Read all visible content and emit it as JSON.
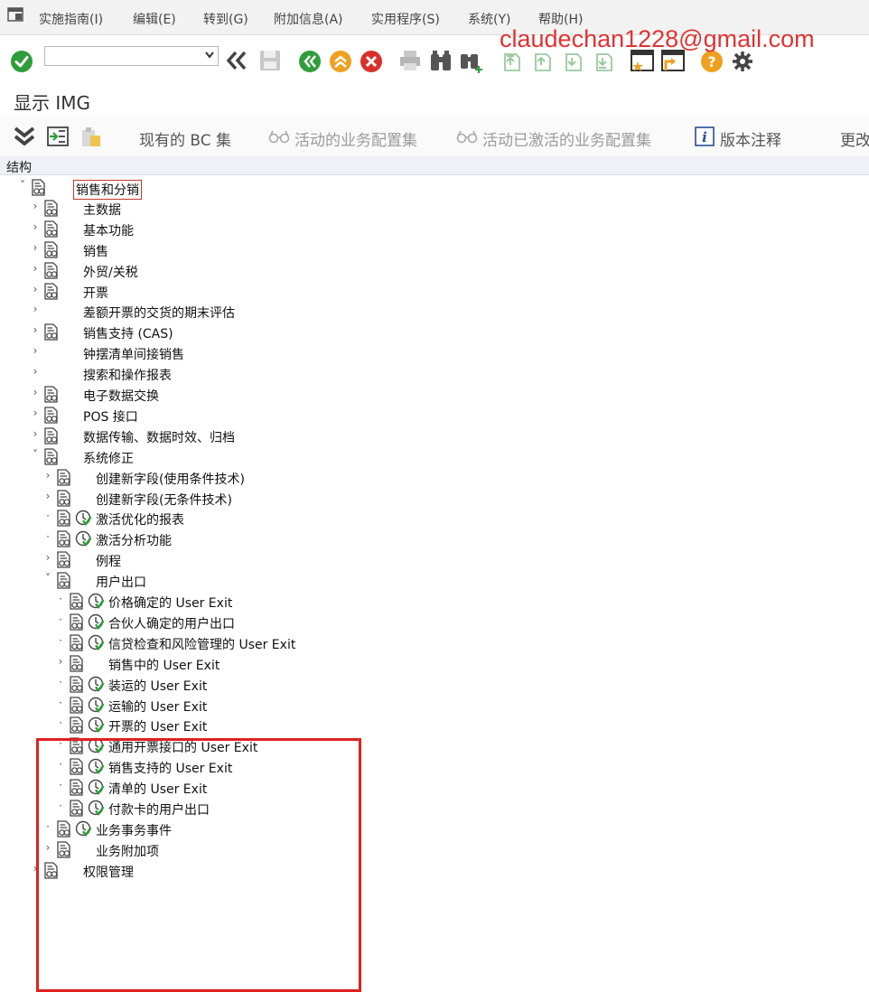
{
  "menu": [
    "实施指南(I)",
    "编辑(E)",
    "转到(G)",
    "附加信息(A)",
    "实用程序(S)",
    "系统(Y)",
    "帮助(H)"
  ],
  "watermark": "claudechan1228@gmail.com",
  "command_field": {
    "value": "",
    "placeholder": ""
  },
  "title": "显示 IMG",
  "app_toolbar": {
    "existing_bc_sets": "现有的 BC 集",
    "active_bc_sets": "活动的业务配置集",
    "activated_bc_sets": "活动已激活的业务配置集",
    "release_notes": "版本注释",
    "changes": "更改"
  },
  "structure_label": "结构",
  "tree": [
    {
      "label": "销售和分销",
      "level": 0,
      "toggle": "v",
      "doc": true,
      "clock": false
    },
    {
      "label": "主数据",
      "level": 1,
      "toggle": ">",
      "doc": true,
      "clock": false
    },
    {
      "label": "基本功能",
      "level": 1,
      "toggle": ">",
      "doc": true,
      "clock": false
    },
    {
      "label": "销售",
      "level": 1,
      "toggle": ">",
      "doc": true,
      "clock": false
    },
    {
      "label": "外贸/关税",
      "level": 1,
      "toggle": ">",
      "doc": true,
      "clock": false
    },
    {
      "label": "开票",
      "level": 1,
      "toggle": ">",
      "doc": true,
      "clock": false
    },
    {
      "label": "差额开票的交货的期末评估",
      "level": 1,
      "toggle": ">",
      "doc": false,
      "clock": false
    },
    {
      "label": "销售支持 (CAS)",
      "level": 1,
      "toggle": ">",
      "doc": true,
      "clock": false
    },
    {
      "label": "钟摆清单间接销售",
      "level": 1,
      "toggle": ">",
      "doc": false,
      "clock": false
    },
    {
      "label": "搜索和操作报表",
      "level": 1,
      "toggle": ">",
      "doc": false,
      "clock": false
    },
    {
      "label": "电子数据交换",
      "level": 1,
      "toggle": ">",
      "doc": true,
      "clock": false
    },
    {
      "label": "POS 接口",
      "level": 1,
      "toggle": ">",
      "doc": true,
      "clock": false
    },
    {
      "label": "数据传输、数据时效、归档",
      "level": 1,
      "toggle": ">",
      "doc": true,
      "clock": false
    },
    {
      "label": "系统修正",
      "level": 1,
      "toggle": "v",
      "doc": true,
      "clock": false
    },
    {
      "label": "创建新字段(使用条件技术)",
      "level": 2,
      "toggle": ">",
      "doc": true,
      "clock": false
    },
    {
      "label": "创建新字段(无条件技术)",
      "level": 2,
      "toggle": ">",
      "doc": true,
      "clock": false
    },
    {
      "label": "激活优化的报表",
      "level": 2,
      "toggle": "·",
      "doc": true,
      "clock": true
    },
    {
      "label": "激活分析功能",
      "level": 2,
      "toggle": "·",
      "doc": true,
      "clock": true
    },
    {
      "label": "例程",
      "level": 2,
      "toggle": ">",
      "doc": true,
      "clock": false
    },
    {
      "label": "用户出口",
      "level": 2,
      "toggle": "v",
      "doc": true,
      "clock": false
    },
    {
      "label": "价格确定的 User Exit",
      "level": 3,
      "toggle": "·",
      "doc": true,
      "clock": true
    },
    {
      "label": "合伙人确定的用户出口",
      "level": 3,
      "toggle": "·",
      "doc": true,
      "clock": true
    },
    {
      "label": "信贷检查和风险管理的 User Exit",
      "level": 3,
      "toggle": "·",
      "doc": true,
      "clock": true
    },
    {
      "label": "销售中的 User Exit",
      "level": 3,
      "toggle": ">",
      "doc": true,
      "clock": false
    },
    {
      "label": "装运的 User Exit",
      "level": 3,
      "toggle": "·",
      "doc": true,
      "clock": true
    },
    {
      "label": "运输的 User Exit",
      "level": 3,
      "toggle": "·",
      "doc": true,
      "clock": true
    },
    {
      "label": "开票的 User Exit",
      "level": 3,
      "toggle": "·",
      "doc": true,
      "clock": true
    },
    {
      "label": "通用开票接口的 User Exit",
      "level": 3,
      "toggle": "·",
      "doc": true,
      "clock": true
    },
    {
      "label": "销售支持的 User Exit",
      "level": 3,
      "toggle": "·",
      "doc": true,
      "clock": true
    },
    {
      "label": "清单的 User Exit",
      "level": 3,
      "toggle": "·",
      "doc": true,
      "clock": true
    },
    {
      "label": "付款卡的用户出口",
      "level": 3,
      "toggle": "·",
      "doc": true,
      "clock": true
    },
    {
      "label": "业务事务事件",
      "level": 2,
      "toggle": "·",
      "doc": true,
      "clock": true
    },
    {
      "label": "业务附加项",
      "level": 2,
      "toggle": ">",
      "doc": true,
      "clock": false
    },
    {
      "label": "权限管理",
      "level": 1,
      "toggle": ">",
      "doc": true,
      "clock": false
    }
  ],
  "colors": {
    "accent_green": "#2e9e3a",
    "accent_orange": "#f0a020",
    "accent_red": "#d9302c",
    "highlight_frame": "#e02020"
  }
}
